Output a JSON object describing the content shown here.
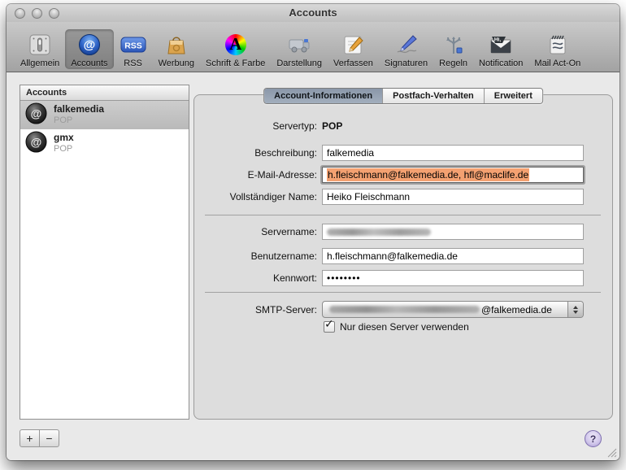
{
  "window": {
    "title": "Accounts"
  },
  "toolbar": {
    "items": [
      {
        "label": "Allgemein"
      },
      {
        "label": "Accounts"
      },
      {
        "label": "RSS"
      },
      {
        "label": "Werbung"
      },
      {
        "label": "Schrift & Farbe"
      },
      {
        "label": "Darstellung"
      },
      {
        "label": "Verfassen"
      },
      {
        "label": "Signaturen"
      },
      {
        "label": "Regeln"
      },
      {
        "label": "Notification"
      },
      {
        "label": "Mail Act-On"
      }
    ]
  },
  "sidebar": {
    "header": "Accounts",
    "accounts": [
      {
        "name": "falkemedia",
        "protocol": "POP"
      },
      {
        "name": "gmx",
        "protocol": "POP"
      }
    ],
    "add_button": "+",
    "remove_button": "−"
  },
  "tabs": {
    "items": [
      {
        "label": "Account-Informationen"
      },
      {
        "label": "Postfach-Verhalten"
      },
      {
        "label": "Erweitert"
      }
    ]
  },
  "form": {
    "servertyp_label": "Servertyp:",
    "servertyp_value": "POP",
    "beschreibung_label": "Beschreibung:",
    "beschreibung_value": "falkemedia",
    "email_label": "E-Mail-Adresse:",
    "email_value": "h.fleischmann@falkemedia.de, hfl@maclife.de",
    "fullname_label": "Vollständiger Name:",
    "fullname_value": "Heiko Fleischmann",
    "servername_label": "Servername:",
    "benutzername_label": "Benutzername:",
    "benutzername_value": "h.fleischmann@falkemedia.de",
    "kennwort_label": "Kennwort:",
    "kennwort_value": "••••••••",
    "smtp_label": "SMTP-Server:",
    "smtp_value_suffix": "@falkemedia.de",
    "smtp_checkbox_label": "Nur diesen Server verwenden"
  },
  "footer": {
    "help_label": "?"
  },
  "colors": {
    "selection_highlight": "#f4a171",
    "tab_selected": "#94a1b2",
    "accent_blue": "#2b62c6"
  }
}
